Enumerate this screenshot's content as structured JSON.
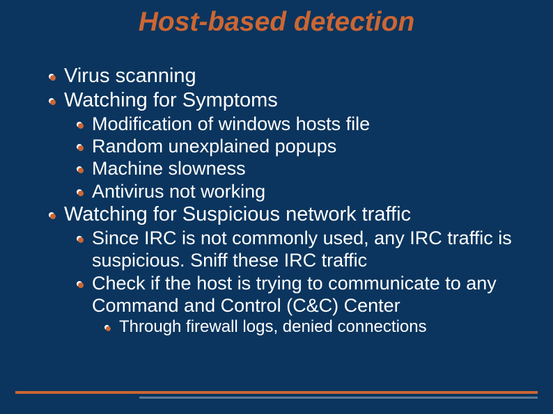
{
  "title": "Host-based detection",
  "bullets": {
    "item1": "Virus scanning",
    "item2": "Watching for Symptoms",
    "item2_1": "Modification of windows hosts file",
    "item2_2": "Random unexplained popups",
    "item2_3": "Machine slowness",
    "item2_4": "Antivirus not working",
    "item3": "Watching for Suspicious network traffic",
    "item3_1": "Since IRC is not commonly used, any IRC traffic is suspicious. Sniff these IRC traffic",
    "item3_2": "Check if the host is trying to communicate to any Command and Control (C&C) Center",
    "item3_2_1": "Through firewall logs, denied connections"
  }
}
